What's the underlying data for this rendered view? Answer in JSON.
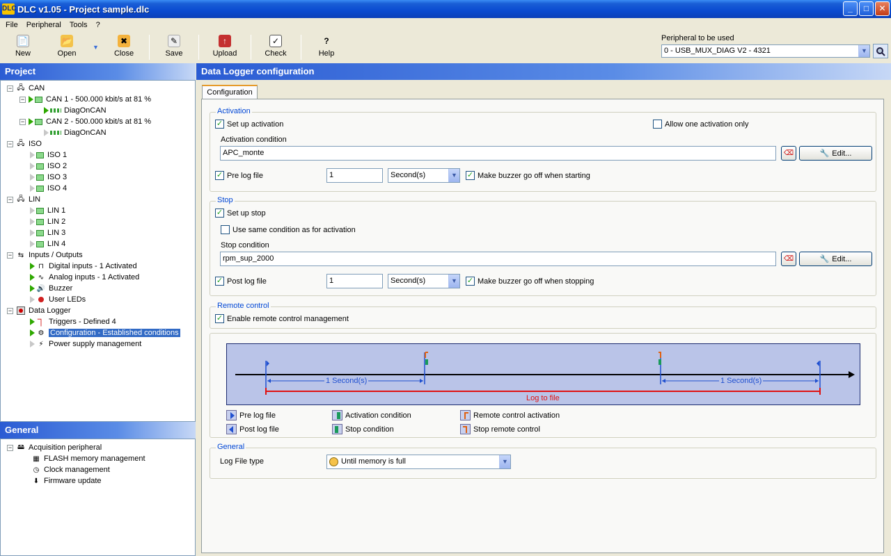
{
  "window": {
    "title": "DLC v1.05 - Project sample.dlc",
    "app_icon": "DLC"
  },
  "menu": [
    "File",
    "Peripheral",
    "Tools",
    "?"
  ],
  "toolbar": {
    "new": "New",
    "open": "Open",
    "close": "Close",
    "save": "Save",
    "upload": "Upload",
    "check": "Check",
    "help": "Help"
  },
  "peripheral": {
    "label": "Peripheral to be used",
    "value": "0 - USB_MUX_DIAG V2 - 4321"
  },
  "project": {
    "title": "Project",
    "can": "CAN",
    "can1": "CAN 1 - 500.000 kbit/s at 81 %",
    "can1_child": "DiagOnCAN",
    "can2": "CAN 2 - 500.000 kbit/s at 81 %",
    "can2_child": "DiagOnCAN",
    "iso": "ISO",
    "iso_items": [
      "ISO 1",
      "ISO 2",
      "ISO 3",
      "ISO 4"
    ],
    "lin": "LIN",
    "lin_items": [
      "LIN 1",
      "LIN 2",
      "LIN 3",
      "LIN 4"
    ],
    "io": "Inputs / Outputs",
    "digital": "Digital inputs - 1 Activated",
    "analog": "Analog inputs - 1 Activated",
    "buzzer": "Buzzer",
    "leds": "User LEDs",
    "logger": "Data Logger",
    "triggers": "Triggers - Defined 4",
    "configuration": "Configuration - Established conditions",
    "power": "Power supply management"
  },
  "general_panel": {
    "title": "General",
    "acq": "Acquisition peripheral",
    "flash": "FLASH memory management",
    "clock": "Clock management",
    "firmware": "Firmware update"
  },
  "config": {
    "header": "Data Logger configuration",
    "tab": "Configuration",
    "activation": {
      "title": "Activation",
      "setup": "Set up activation",
      "one_only": "Allow one activation only",
      "cond_label": "Activation condition",
      "cond_value": "APC_monte",
      "edit": "Edit...",
      "prelog": "Pre log file",
      "prelog_value": "1",
      "unit": "Second(s)",
      "buzzer": "Make buzzer go off when starting"
    },
    "stop": {
      "title": "Stop",
      "setup": "Set up stop",
      "same": "Use same condition as for activation",
      "cond_label": "Stop condition",
      "cond_value": "rpm_sup_2000",
      "edit": "Edit...",
      "postlog": "Post log file",
      "postlog_value": "1",
      "unit": "Second(s)",
      "buzzer": "Make buzzer go off when stopping"
    },
    "remote": {
      "title": "Remote control",
      "enable": "Enable remote control management"
    },
    "timeline": {
      "left_span": "1 Second(s)",
      "right_span": "1 Second(s)",
      "log_label": "Log to file"
    },
    "legend": {
      "pre": "Pre log file",
      "post": "Post log file",
      "act": "Activation condition",
      "stopc": "Stop condition",
      "remote_act": "Remote control activation",
      "remote_stop": "Stop remote control"
    },
    "general": {
      "title": "General",
      "type_label": "Log File type",
      "type_value": "Until memory is full"
    }
  }
}
